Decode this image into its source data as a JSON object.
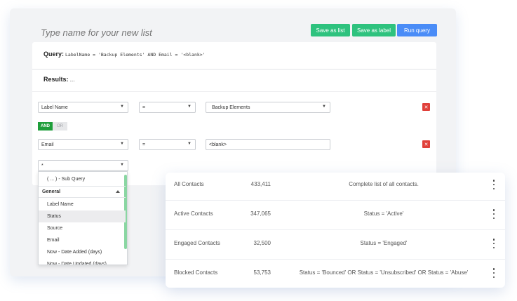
{
  "header": {
    "list_name_placeholder": "Type name for your new list",
    "save_list_label": "Save as list",
    "save_label_label": "Save as label",
    "run_query_label": "Run query"
  },
  "query": {
    "label": "Query:",
    "text": "LabelName = 'Backup Elements' AND Email = '<blank>'"
  },
  "results": {
    "label": "Results:",
    "value": "..."
  },
  "conditions": [
    {
      "field": "Label Name",
      "operator": "=",
      "value": "Backup Elements"
    },
    {
      "field": "Email",
      "operator": "=",
      "value": "<blank>"
    }
  ],
  "logic": {
    "and_label": "AND",
    "or_label": "OR"
  },
  "new_field": {
    "value": "*"
  },
  "dropdown": {
    "subquery_label": "( ... ) - Sub Query",
    "group_label": "General",
    "items": [
      "Label Name",
      "Status",
      "Source",
      "Email",
      "Now - Date Added (days)",
      "Now - Date Updated (days)"
    ]
  },
  "contacts": [
    {
      "name": "All Contacts",
      "count": "433,411",
      "description": "Complete list of all contacts."
    },
    {
      "name": "Active Contacts",
      "count": "347,065",
      "description": "Status = 'Active'"
    },
    {
      "name": "Engaged Contacts",
      "count": "32,500",
      "description": "Status = 'Engaged'"
    },
    {
      "name": "Blocked Contacts",
      "count": "53,753",
      "description": "Status = 'Bounced' OR Status = 'Unsubscribed' OR Status = 'Abuse'"
    }
  ],
  "colors": {
    "green_button": "#2ec27e",
    "blue_button": "#4a8cf7",
    "delete": "#e0403a",
    "and_active": "#1e9e3a"
  }
}
